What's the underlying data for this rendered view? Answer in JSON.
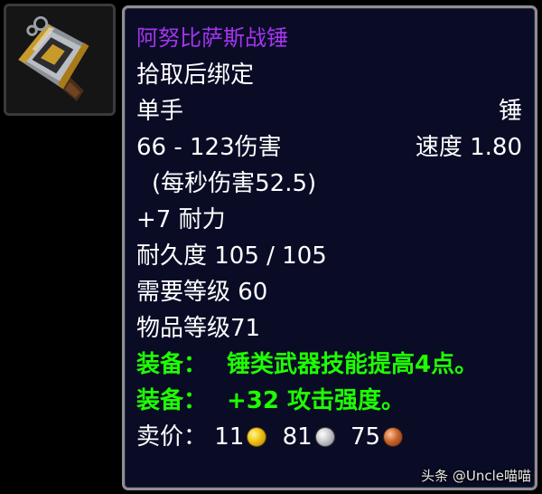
{
  "item": {
    "name": "阿努比萨斯战锤",
    "binding": "拾取后绑定",
    "slot": "单手",
    "type": "锤",
    "damage": "66 - 123伤害",
    "speed": "速度 1.80",
    "dps": "(每秒伤害52.5)",
    "stat": "+7 耐力",
    "durability": "耐久度 105 / 105",
    "required_level": "需要等级 60",
    "item_level": "物品等级71",
    "equip_effects": [
      {
        "label": "装备：",
        "text": "锤类武器技能提高4点。"
      },
      {
        "label": "装备：",
        "text": "+32 攻击强度。"
      }
    ],
    "sell_price": {
      "label": "卖价：",
      "gold": "11",
      "silver": "81",
      "copper": "75"
    }
  },
  "colors": {
    "epic": "#a335ee",
    "equip": "#1eff00",
    "text": "#ffffff",
    "background": "#0a0c26"
  },
  "icons": {
    "item": "warhammer-icon",
    "gold": "gold-coin-icon",
    "silver": "silver-coin-icon",
    "copper": "copper-coin-icon"
  },
  "watermark": "头条 @Uncle喵喵"
}
